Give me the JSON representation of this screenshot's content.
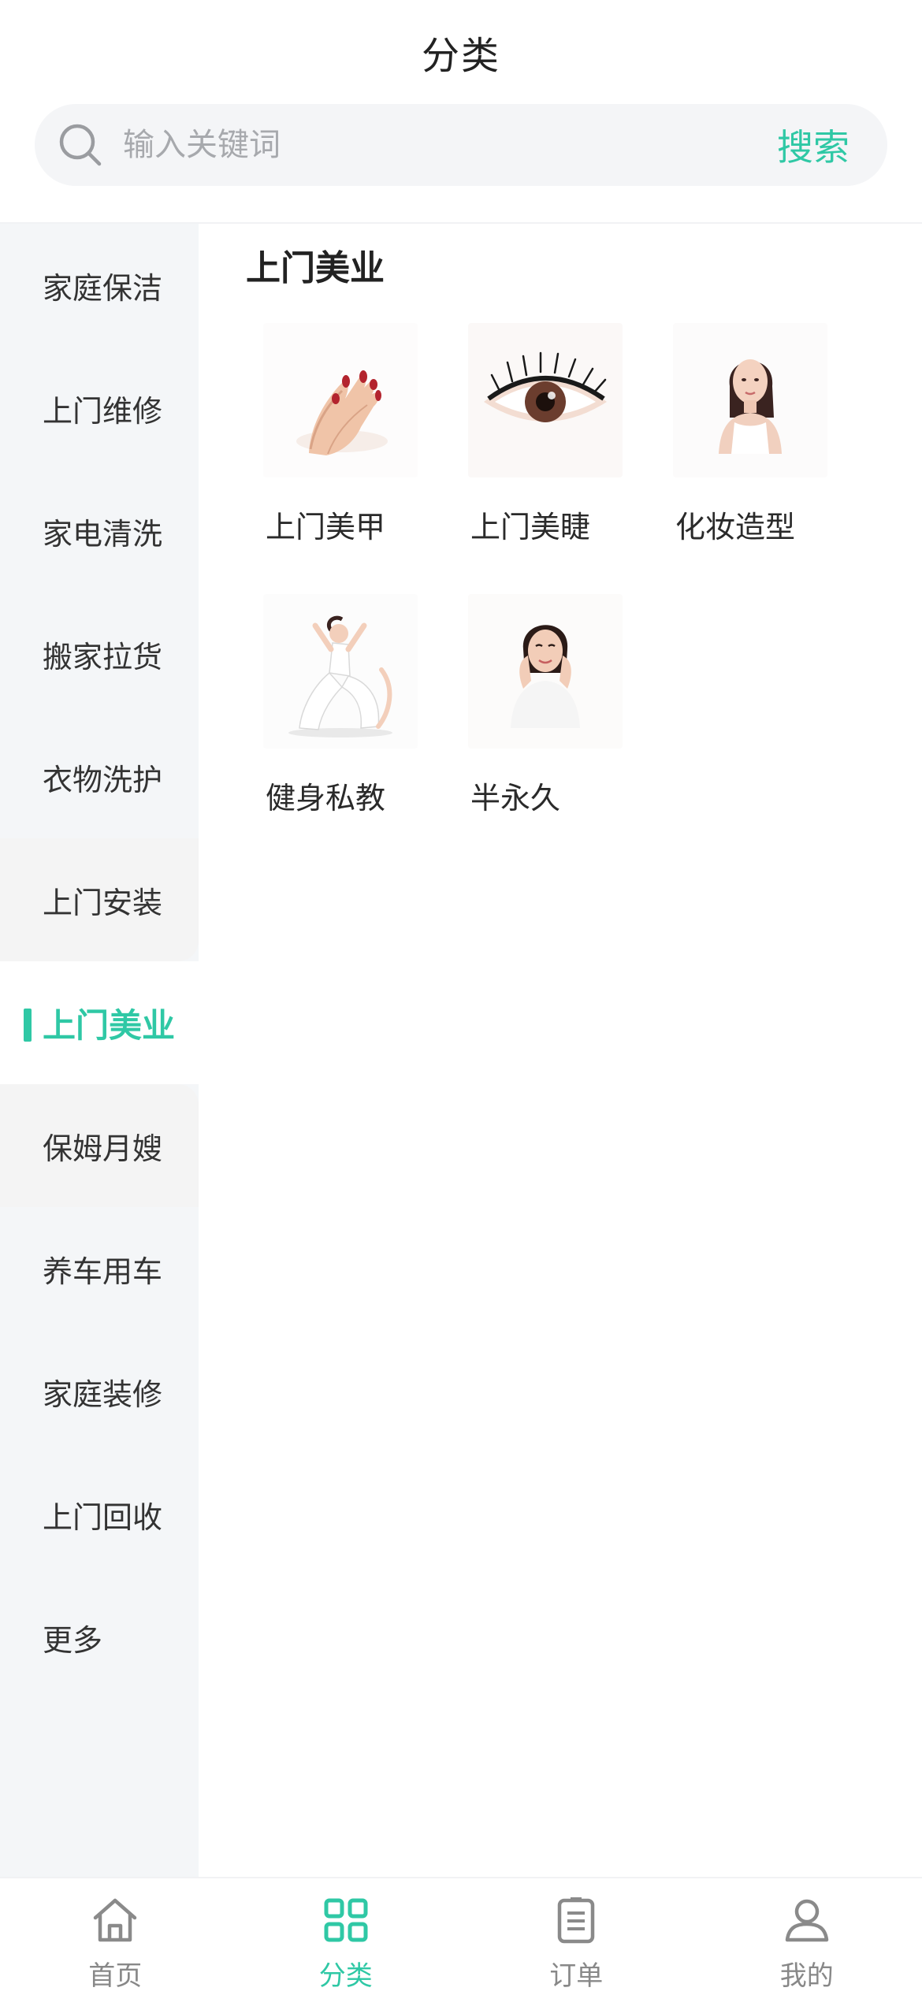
{
  "header": {
    "title": "分类"
  },
  "search": {
    "placeholder": "输入关键词",
    "button_label": "搜索",
    "icon": "search-icon"
  },
  "sidebar": {
    "items": [
      {
        "label": "家庭保洁"
      },
      {
        "label": "上门维修"
      },
      {
        "label": "家电清洗"
      },
      {
        "label": "搬家拉货"
      },
      {
        "label": "衣物洗护"
      },
      {
        "label": "上门安装"
      },
      {
        "label": "上门美业",
        "active": true
      },
      {
        "label": "保姆月嫂"
      },
      {
        "label": "养车用车"
      },
      {
        "label": "家庭装修"
      },
      {
        "label": "上门回收"
      },
      {
        "label": "更多"
      }
    ]
  },
  "content": {
    "title": "上门美业",
    "items": [
      {
        "label": "上门美甲",
        "image": "manicure-hand-photo"
      },
      {
        "label": "上门美睫",
        "image": "eyelash-photo"
      },
      {
        "label": "化妆造型",
        "image": "makeup-model-photo"
      },
      {
        "label": "健身私教",
        "image": "yoga-pose-photo"
      },
      {
        "label": "半永久",
        "image": "semi-permanent-model-photo"
      }
    ]
  },
  "tabbar": {
    "tabs": [
      {
        "label": "首页",
        "icon": "home-icon"
      },
      {
        "label": "分类",
        "icon": "category-grid-icon",
        "active": true
      },
      {
        "label": "订单",
        "icon": "order-list-icon"
      },
      {
        "label": "我的",
        "icon": "user-icon"
      }
    ]
  },
  "colors": {
    "accent": "#2fc8a5",
    "sidebar_bg": "#f4f6f8",
    "search_bg": "#f4f5f7",
    "text": "#222222",
    "muted": "#888888"
  }
}
